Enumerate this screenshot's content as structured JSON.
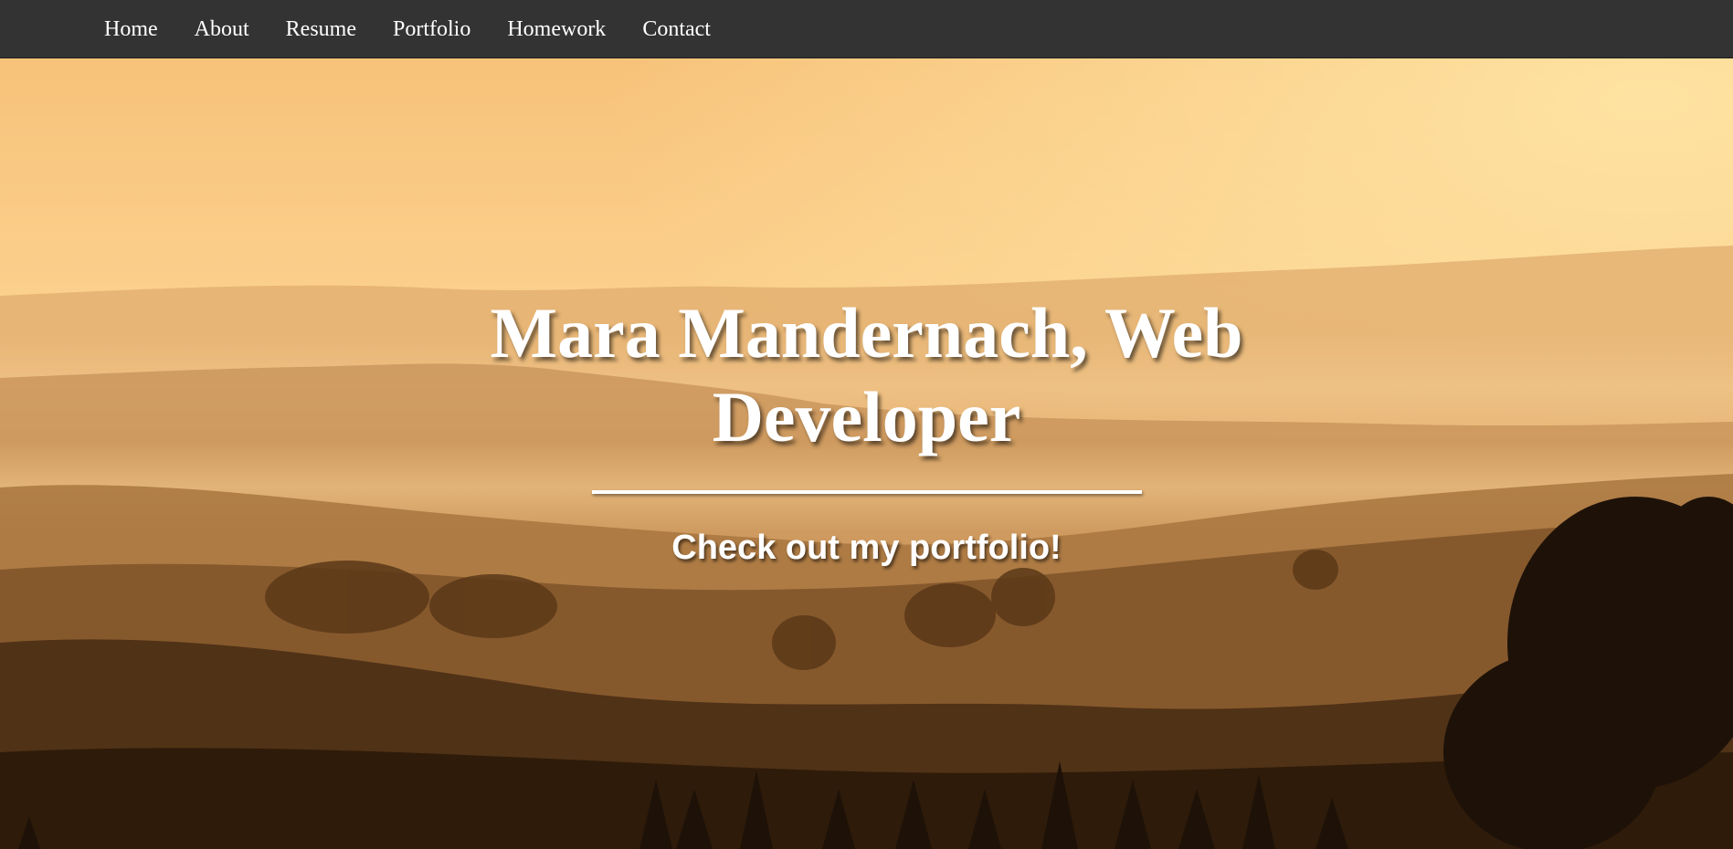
{
  "nav": {
    "items": [
      {
        "label": "Home"
      },
      {
        "label": "About"
      },
      {
        "label": "Resume"
      },
      {
        "label": "Portfolio"
      },
      {
        "label": "Homework"
      },
      {
        "label": "Contact"
      }
    ]
  },
  "hero": {
    "title": "Mara Mandernach, Web Developer",
    "subtitle": "Check out my portfolio!",
    "background_image": "misty-sunrise-hills-landscape"
  },
  "colors": {
    "navbar_bg": "#333333",
    "nav_text": "#ffffff",
    "hero_text": "#ffffff",
    "sky_top": "#f6c377",
    "ground_dark": "#3a2410"
  }
}
